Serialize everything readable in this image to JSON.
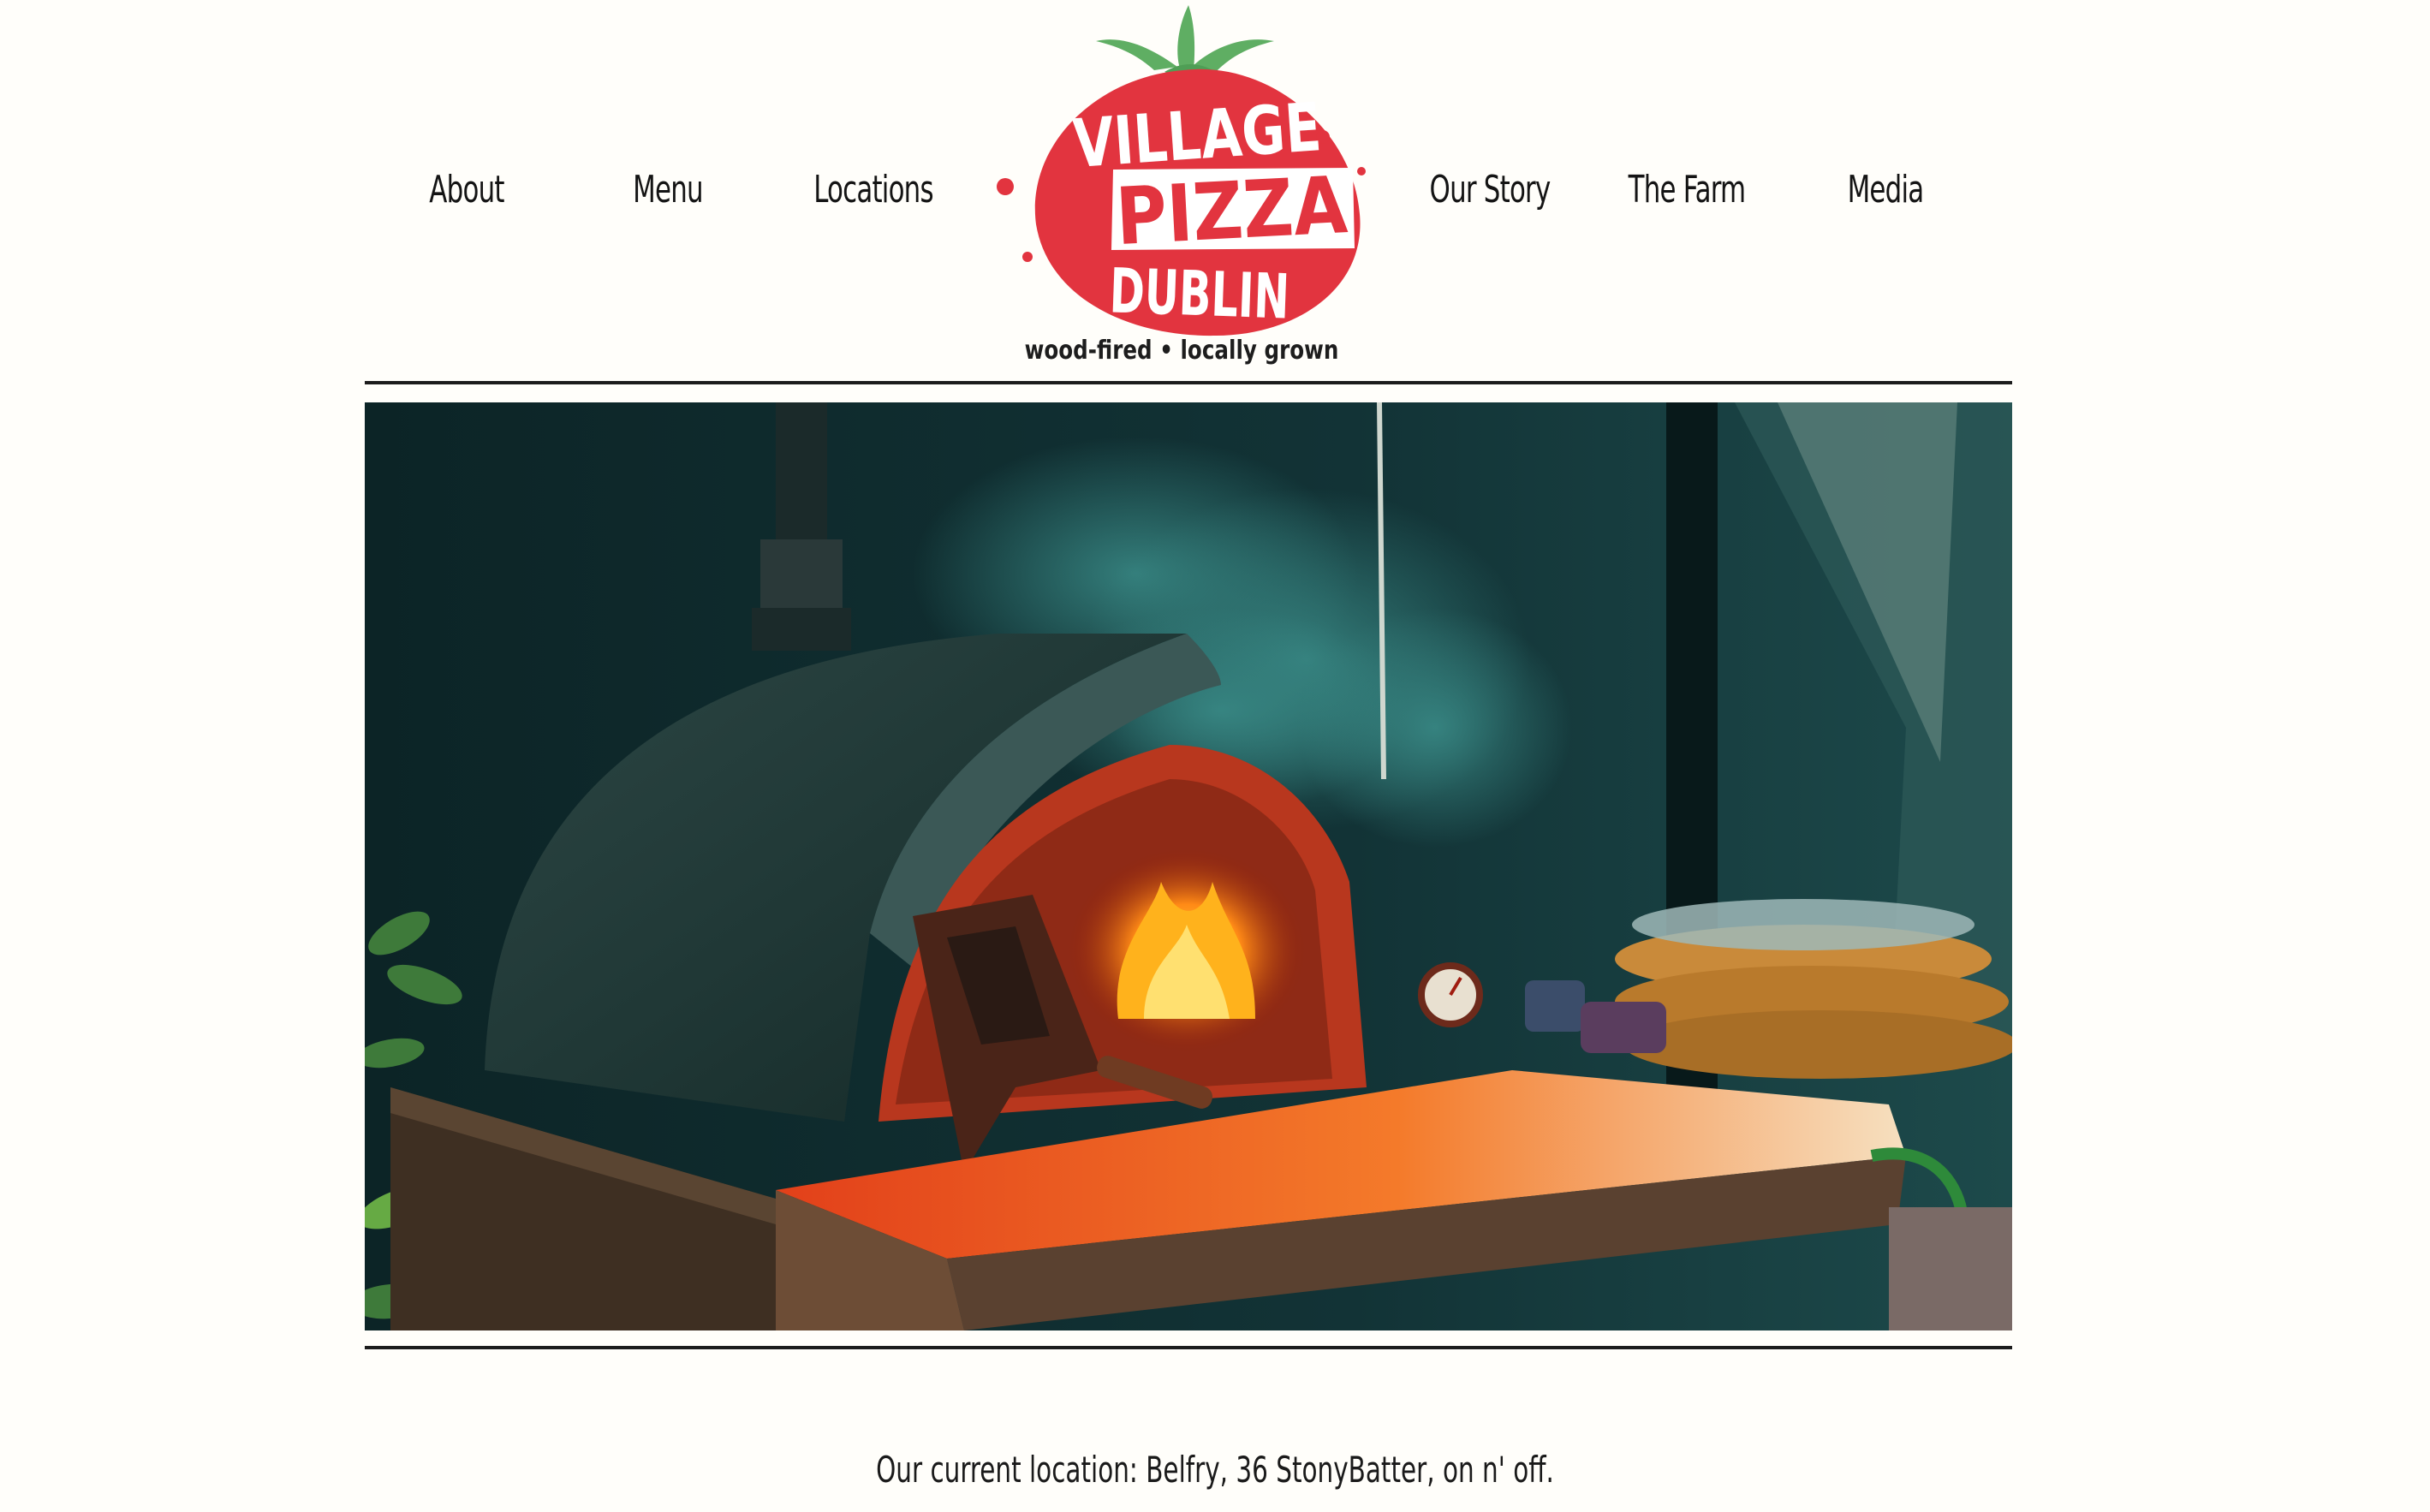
{
  "nav": {
    "left": [
      {
        "label": "About"
      },
      {
        "label": "Menu"
      },
      {
        "label": "Locations"
      }
    ],
    "right": [
      {
        "label": "Our Story"
      },
      {
        "label": "The Farm"
      },
      {
        "label": "Media"
      }
    ]
  },
  "logo": {
    "line1": "VILLAGE",
    "line2": "PIZZA",
    "line3": "DUBLIN",
    "tagline": "wood-fired • locally grown",
    "colors": {
      "tomato": "#e2343f",
      "leaf": "#5fae63",
      "ink": "#ffffff"
    }
  },
  "hero": {
    "image": "wood-fired-pizza-oven-photo"
  },
  "footer_note": {
    "location": "Our current location: Belfry, 36 StonyBatter, on n' off."
  },
  "colors": {
    "background": "#fffefa",
    "text": "#1a1a1a",
    "rule": "#1c1c1c"
  }
}
